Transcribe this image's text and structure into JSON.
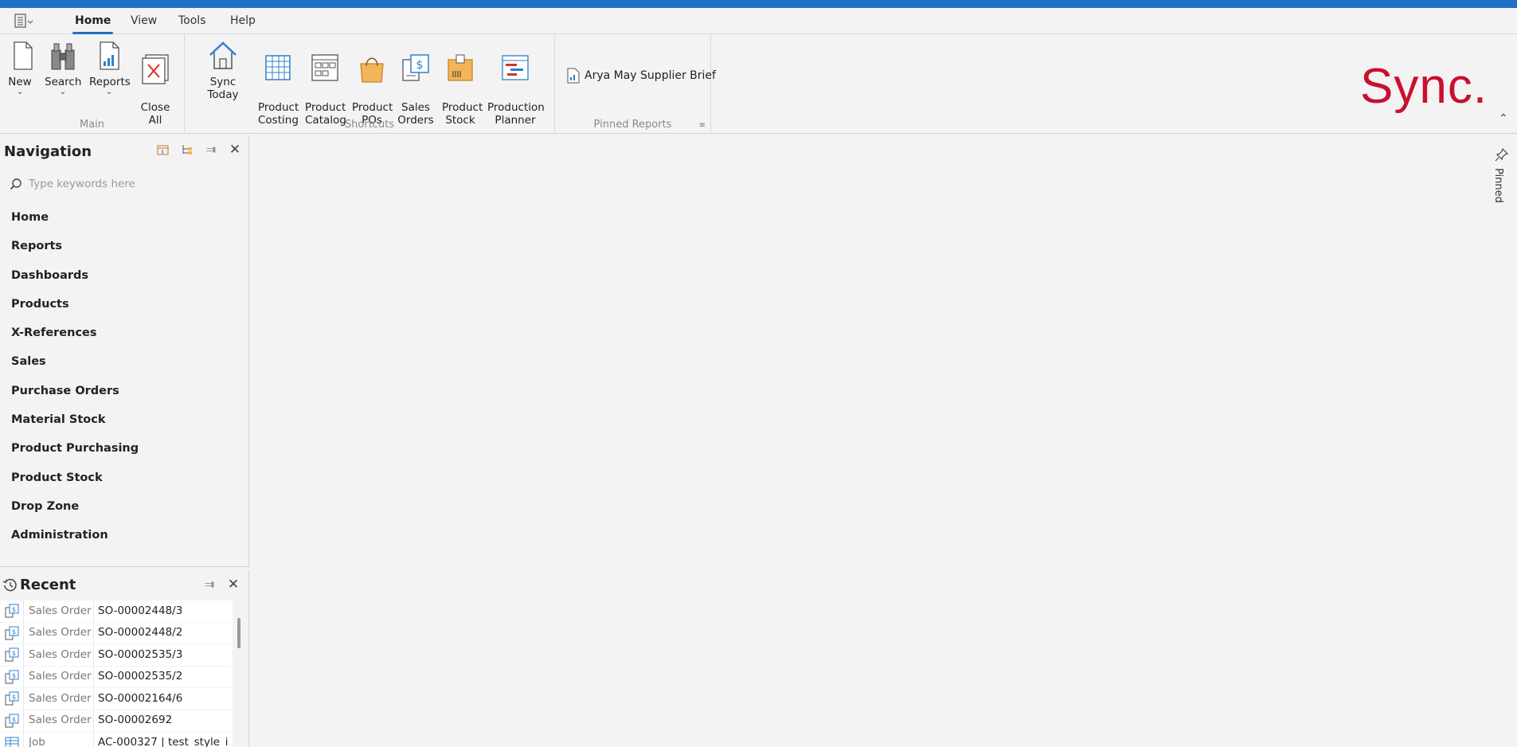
{
  "menubar": {
    "tabs": [
      "Home",
      "View",
      "Tools",
      "Help"
    ]
  },
  "ribbon": {
    "main": {
      "label": "Main",
      "buttons": [
        "New",
        "Search",
        "Reports",
        "Close\nAll"
      ]
    },
    "shortcuts": {
      "label": "Shortcuts",
      "buttons": [
        "Sync Today",
        "Product\nCosting",
        "Product\nCatalog",
        "Product\nPOs",
        "Sales\nOrders",
        "Product\nStock",
        "Production\nPlanner"
      ]
    },
    "pinned_reports": {
      "label": "Pinned Reports",
      "item": "Arya May Supplier Brief"
    },
    "logo_text": "Sync."
  },
  "navigation": {
    "title": "Navigation",
    "search_placeholder": "Type keywords here",
    "items": [
      "Home",
      "Reports",
      "Dashboards",
      "Products",
      "X-References",
      "Sales",
      "Purchase Orders",
      "Material Stock",
      "Product Purchasing",
      "Product Stock",
      "Drop Zone",
      "Administration"
    ]
  },
  "recent": {
    "title": "Recent",
    "rows": [
      {
        "type": "Sales Order",
        "name": "SO-00002448/3"
      },
      {
        "type": "Sales Order",
        "name": "SO-00002448/2"
      },
      {
        "type": "Sales Order",
        "name": "SO-00002535/3"
      },
      {
        "type": "Sales Order",
        "name": "SO-00002535/2"
      },
      {
        "type": "Sales Order",
        "name": "SO-00002164/6"
      },
      {
        "type": "Sales Order",
        "name": "SO-00002692"
      },
      {
        "type": "Job",
        "name": "AC-000327 | test_style_i"
      }
    ]
  },
  "side_panel": {
    "pinned_label": "Pinned"
  },
  "colors": {
    "accent": "#1f6fc5",
    "logo": "#c8102e"
  }
}
